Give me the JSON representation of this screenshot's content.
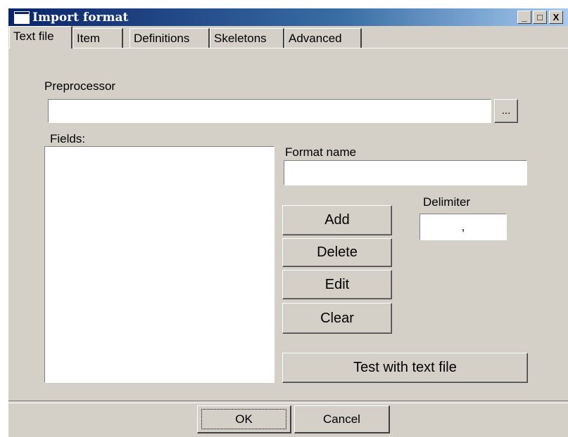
{
  "window": {
    "title": "Import format"
  },
  "title_buttons": {
    "minimize": "_",
    "maximize": "□",
    "close": "X"
  },
  "tabs": [
    {
      "label": "Text file",
      "active": true
    },
    {
      "label": "Item"
    },
    {
      "label": "Definitions"
    },
    {
      "label": "Skeletons"
    },
    {
      "label": "Advanced"
    }
  ],
  "preprocessor": {
    "label": "Preprocessor",
    "value": "",
    "browse_label": "..."
  },
  "fields": {
    "label": "Fields:"
  },
  "format_name": {
    "label": "Format name",
    "value": ""
  },
  "delimiter": {
    "label": "Delimiter",
    "value": ","
  },
  "buttons": {
    "add": "Add",
    "delete": "Delete",
    "edit": "Edit",
    "clear": "Clear",
    "test": "Test with text file"
  },
  "footer": {
    "ok": "OK",
    "cancel": "Cancel"
  }
}
